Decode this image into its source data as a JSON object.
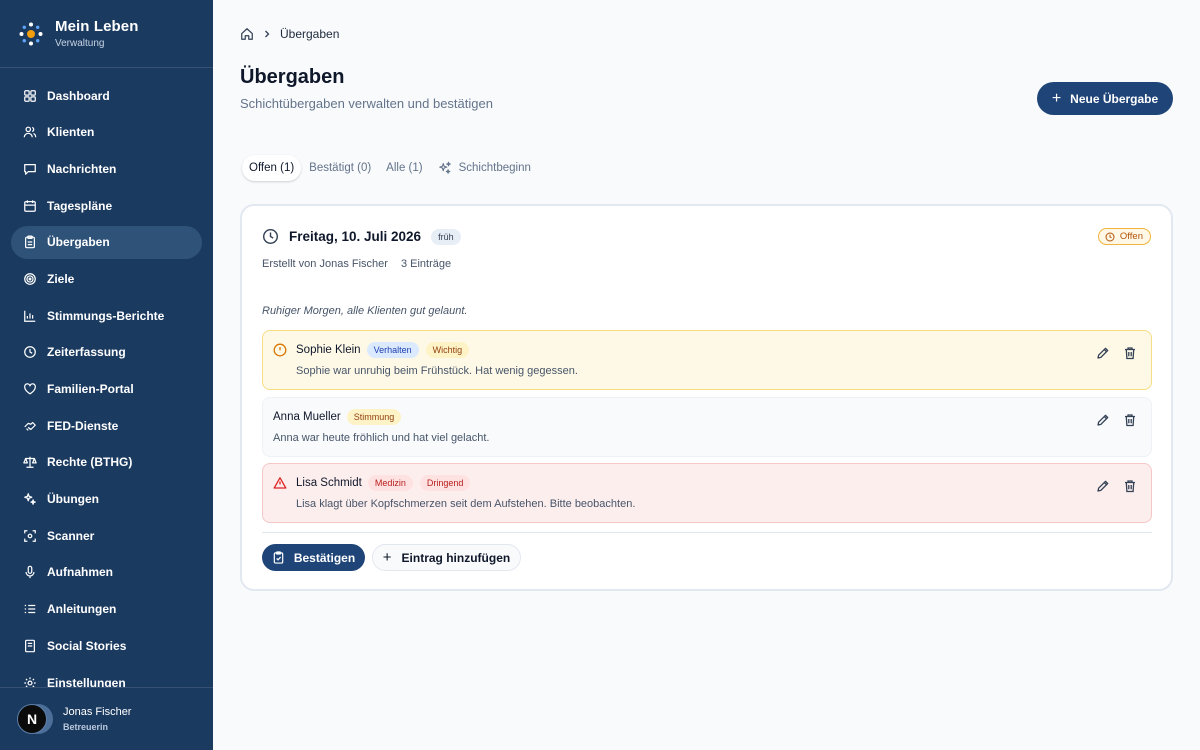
{
  "brand": {
    "title": "Mein Leben",
    "subtitle": "Verwaltung"
  },
  "sidebar": {
    "items": [
      {
        "label": "Dashboard",
        "icon": "grid-icon"
      },
      {
        "label": "Klienten",
        "icon": "users-icon"
      },
      {
        "label": "Nachrichten",
        "icon": "message-icon"
      },
      {
        "label": "Tagespläne",
        "icon": "calendar-icon"
      },
      {
        "label": "Übergaben",
        "icon": "clipboard-icon",
        "active": true
      },
      {
        "label": "Ziele",
        "icon": "target-icon"
      },
      {
        "label": "Stimmungs-Berichte",
        "icon": "bar-chart-icon"
      },
      {
        "label": "Zeiterfassung",
        "icon": "clock-icon"
      },
      {
        "label": "Familien-Portal",
        "icon": "heart-icon"
      },
      {
        "label": "FED-Dienste",
        "icon": "handshake-icon"
      },
      {
        "label": "Rechte (BTHG)",
        "icon": "scale-icon"
      },
      {
        "label": "Übungen",
        "icon": "puzzle-icon"
      },
      {
        "label": "Scanner",
        "icon": "scan-icon"
      },
      {
        "label": "Aufnahmen",
        "icon": "mic-icon"
      },
      {
        "label": "Anleitungen",
        "icon": "list-icon"
      },
      {
        "label": "Social Stories",
        "icon": "book-icon"
      },
      {
        "label": "Einstellungen",
        "icon": "gear-icon"
      }
    ],
    "user": {
      "initial": "N",
      "name": "Jonas Fischer",
      "role": "Betreuerin"
    }
  },
  "breadcrumb": {
    "current": "Übergaben"
  },
  "header": {
    "title": "Übergaben",
    "subtitle": "Schichtübergaben verwalten und bestätigen",
    "new_button": "Neue Übergabe"
  },
  "tabs": [
    {
      "label": "Offen (1)",
      "active": true
    },
    {
      "label": "Bestätigt (0)"
    },
    {
      "label": "Alle (1)"
    },
    {
      "label": "Schichtbeginn",
      "icon": "sparkles-icon"
    }
  ],
  "handover": {
    "date": "Freitag, 10. Juli 2026",
    "shift": "früh",
    "status": "Offen",
    "created_by": "Erstellt von Jonas Fischer",
    "entry_count": "3 Einträge",
    "note": "Ruhiger Morgen, alle Klienten gut gelaunt.",
    "entries": [
      {
        "name": "Sophie Klein",
        "tags": [
          "Verhalten",
          "Wichtig"
        ],
        "text": "Sophie war unruhig beim Frühstück. Hat wenig gegessen.",
        "level": "warning"
      },
      {
        "name": "Anna Mueller",
        "tags": [
          "Stimmung"
        ],
        "text": "Anna war heute fröhlich und hat viel gelacht.",
        "level": "normal"
      },
      {
        "name": "Lisa Schmidt",
        "tags": [
          "Medizin",
          "Dringend"
        ],
        "text": "Lisa klagt über Kopfschmerzen seit dem Aufstehen. Bitte beobachten.",
        "level": "urgent"
      }
    ],
    "confirm_button": "Bestätigen",
    "add_button": "Eintrag hinzufügen"
  },
  "colors": {
    "sidebar": "#1b3a60",
    "primary": "#1f4478",
    "warning": "#f0b43c",
    "danger": "#dc2626"
  }
}
